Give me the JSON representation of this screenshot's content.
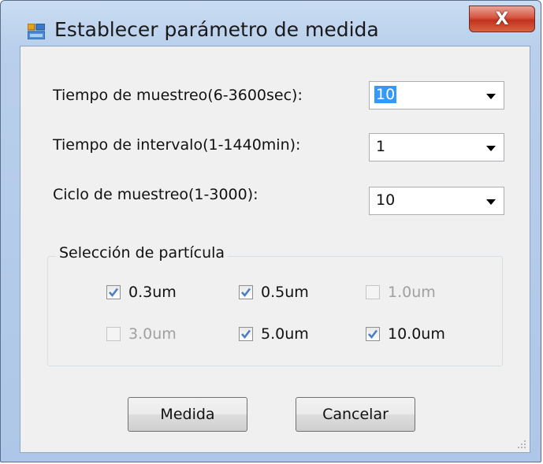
{
  "window": {
    "title": "Establecer parámetro de medida",
    "close_label": "X"
  },
  "form": {
    "sampling_time": {
      "label": "Tiempo de muestreo(6-3600sec):",
      "value": "10"
    },
    "interval_time": {
      "label": "Tiempo de intervalo(1-1440min):",
      "value": "1"
    },
    "sampling_cycle": {
      "label": "Ciclo de muestreo(1-3000):",
      "value": "10"
    }
  },
  "particles": {
    "title": "Selección de partícula",
    "items": [
      {
        "label": "0.3um",
        "checked": true,
        "enabled": true
      },
      {
        "label": "0.5um",
        "checked": true,
        "enabled": true
      },
      {
        "label": "1.0um",
        "checked": false,
        "enabled": false
      },
      {
        "label": "3.0um",
        "checked": false,
        "enabled": false
      },
      {
        "label": "5.0um",
        "checked": true,
        "enabled": true
      },
      {
        "label": "10.0um",
        "checked": true,
        "enabled": true
      }
    ]
  },
  "buttons": {
    "measure_label": "Medida",
    "cancel_label": "Cancelar"
  },
  "colors": {
    "check_mark": "#4a7fc1",
    "selection": "#3399ff"
  }
}
